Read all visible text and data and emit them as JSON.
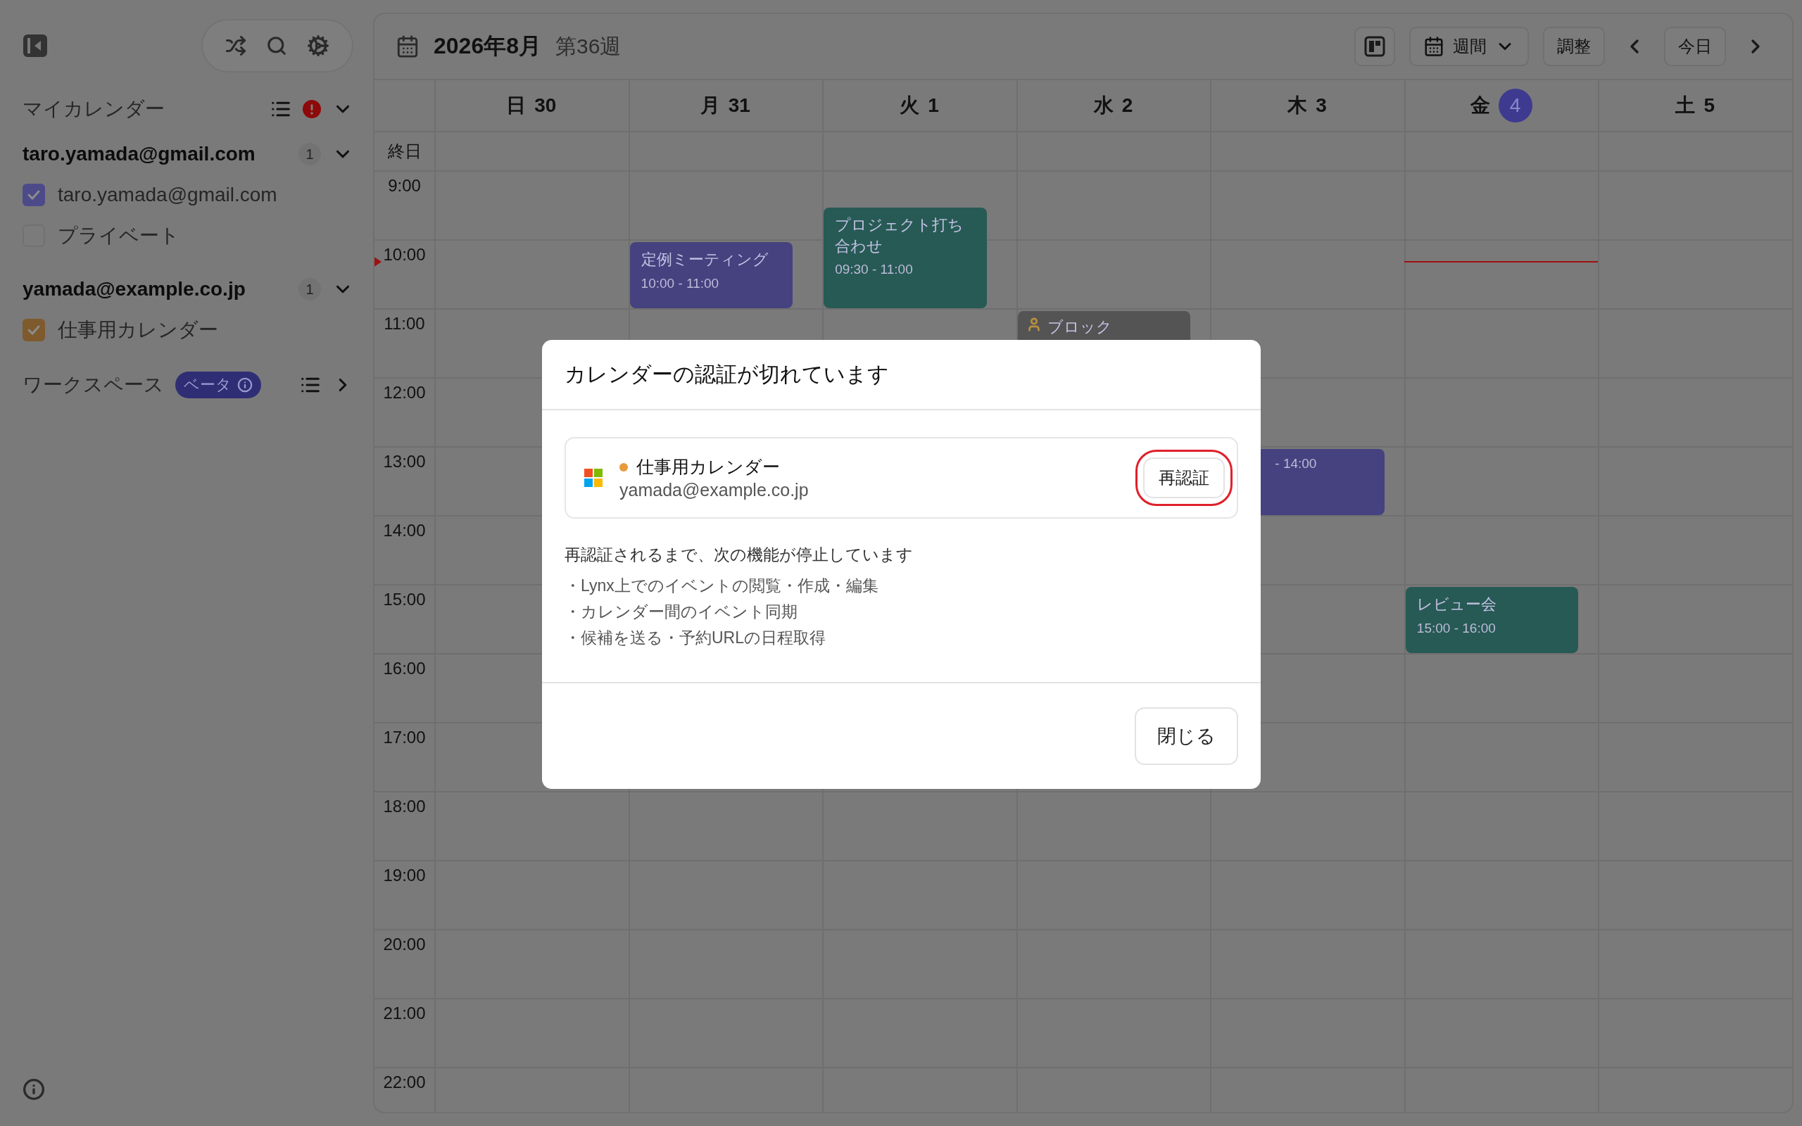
{
  "sidebar": {
    "my_calendars": {
      "title": "マイカレンダー",
      "alert": true,
      "expanded": true
    },
    "accounts": [
      {
        "email": "taro.yamada@gmail.com",
        "count": "1",
        "expanded": true,
        "calendars": [
          {
            "name": "taro.yamada@gmail.com",
            "checked": true,
            "color": "#4d4a8a"
          },
          {
            "name": "プライベート",
            "checked": false
          }
        ]
      },
      {
        "email": "yamada@example.co.jp",
        "count": "1",
        "expanded": true,
        "calendars": [
          {
            "name": "仕事用カレンダー",
            "checked": true,
            "color": "#7e5a2c"
          }
        ]
      }
    ],
    "workspace": {
      "title": "ワークスペース",
      "badge": "ベータ",
      "expanded": false
    }
  },
  "header": {
    "month": "2026年8月",
    "week": "第36週",
    "view": "週間",
    "adjust_button": "調整",
    "today_button": "今日"
  },
  "all_day_label": "終日",
  "hours": [
    "9:00",
    "10:00",
    "11:00",
    "12:00",
    "13:00",
    "14:00",
    "15:00",
    "16:00",
    "17:00",
    "18:00",
    "19:00",
    "20:00",
    "21:00",
    "22:00"
  ],
  "days": [
    {
      "weekday": "日",
      "date": "30",
      "today": false
    },
    {
      "weekday": "月",
      "date": "31",
      "today": false,
      "events": [
        {
          "kind": "event",
          "title": "定例ミーティング",
          "time": "10:00 - 11:00",
          "color": "#46427f"
        }
      ]
    },
    {
      "weekday": "火",
      "date": "1",
      "today": false,
      "events": [
        {
          "kind": "event",
          "title": "プロジェクト打ち合わせ",
          "time": "09:30 - 11:00",
          "color": "#275a55"
        }
      ]
    },
    {
      "weekday": "水",
      "date": "2",
      "today": false,
      "events": [
        {
          "kind": "block",
          "title": "ブロック"
        }
      ]
    },
    {
      "weekday": "木",
      "date": "3",
      "today": false,
      "events": [
        {
          "kind": "event",
          "time": "- 14:00",
          "color": "#46427f"
        }
      ]
    },
    {
      "weekday": "金",
      "date": "4",
      "today": true,
      "now_line": true,
      "events": [
        {
          "kind": "event",
          "title": "レビュー会",
          "time": "15:00 - 16:00",
          "color": "#275a55"
        }
      ]
    },
    {
      "weekday": "土",
      "date": "5",
      "today": false
    }
  ],
  "modal": {
    "title": "カレンダーの認証が切れています",
    "account": {
      "name": "仕事用カレンダー",
      "email": "yamada@example.co.jp",
      "color": "#e89a3a"
    },
    "reauth_button": {
      "label": "再認証",
      "highlighted": true
    },
    "message": "再認証されるまで、次の機能が停止しています",
    "items": [
      "・Lynx上でのイベントの閲覧・作成・編集",
      "・カレンダー間のイベント同期",
      "・候補を送る・予約URLの日程取得"
    ],
    "close_button": "閉じる"
  }
}
